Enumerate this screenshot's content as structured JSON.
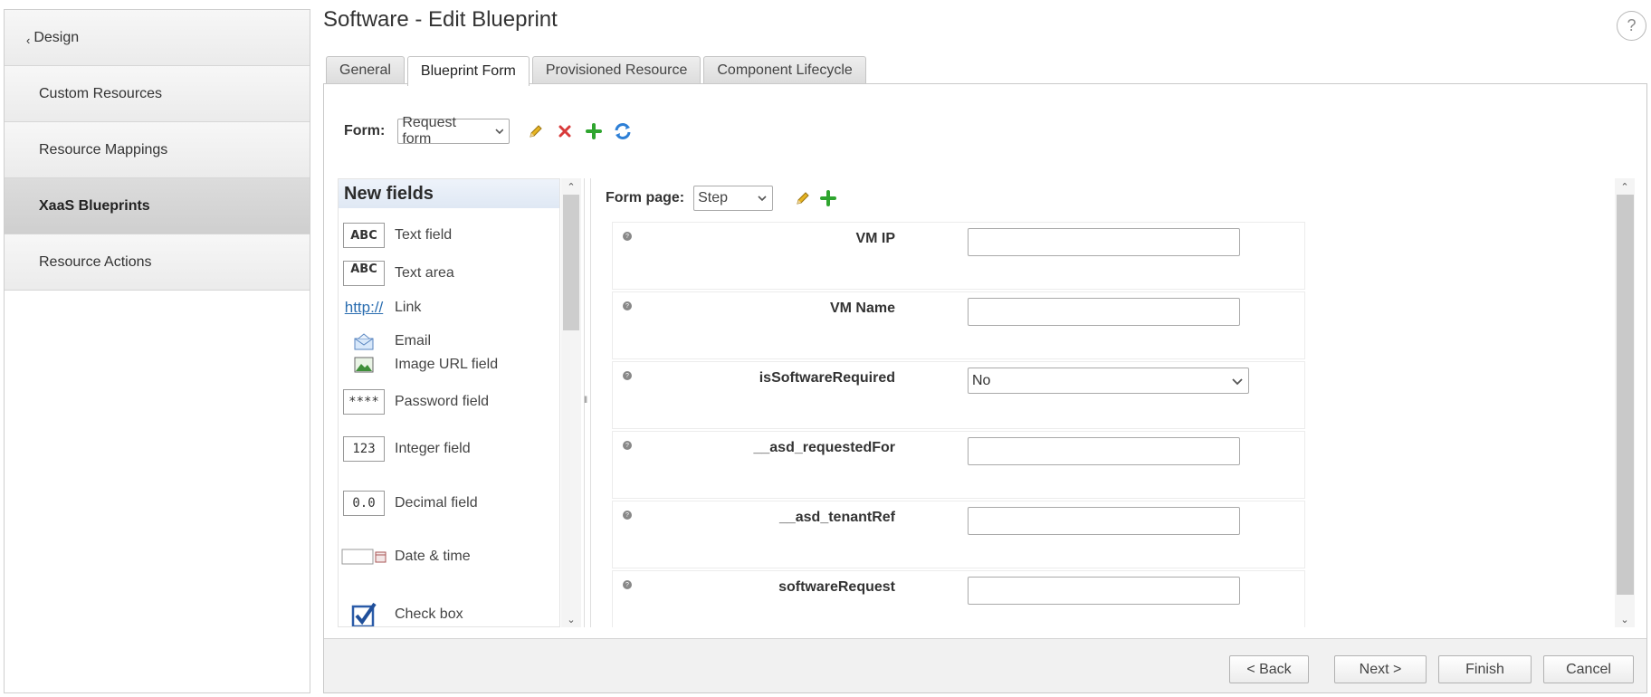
{
  "sidebar": {
    "back_label": "Design",
    "items": [
      {
        "label": "Custom Resources"
      },
      {
        "label": "Resource Mappings"
      },
      {
        "label": "XaaS Blueprints"
      },
      {
        "label": "Resource Actions"
      }
    ],
    "active": "XaaS Blueprints"
  },
  "header": {
    "title": "Software - Edit Blueprint",
    "help": "?"
  },
  "tabs": [
    {
      "label": "General"
    },
    {
      "label": "Blueprint Form"
    },
    {
      "label": "Provisioned Resource"
    },
    {
      "label": "Component Lifecycle"
    }
  ],
  "active_tab": "Blueprint Form",
  "form": {
    "label": "Form:",
    "selected": "Request form"
  },
  "new_fields": {
    "title": "New fields",
    "items": [
      {
        "label": "Text field",
        "icon": "ABC"
      },
      {
        "label": "Text area",
        "icon": "ABC"
      },
      {
        "label": "Link",
        "icon": "http://"
      },
      {
        "label": "Email",
        "icon": "email-icon"
      },
      {
        "label": "Image URL field",
        "icon": "image-icon"
      },
      {
        "label": "Password field",
        "icon": "****"
      },
      {
        "label": "Integer field",
        "icon": "123"
      },
      {
        "label": "Decimal field",
        "icon": "0.0"
      },
      {
        "label": "Date & time",
        "icon": "calendar-icon"
      },
      {
        "label": "Check box",
        "icon": "checkbox-icon"
      }
    ]
  },
  "form_page": {
    "label": "Form page:",
    "selected": "Step"
  },
  "fields": [
    {
      "label": "VM IP",
      "type": "text",
      "value": ""
    },
    {
      "label": "VM Name",
      "type": "text",
      "value": ""
    },
    {
      "label": "isSoftwareRequired",
      "type": "select",
      "value": "No"
    },
    {
      "label": "__asd_requestedFor",
      "type": "text",
      "value": ""
    },
    {
      "label": "__asd_tenantRef",
      "type": "text",
      "value": ""
    },
    {
      "label": "softwareRequest",
      "type": "text",
      "value": ""
    }
  ],
  "footer": {
    "back": "< Back",
    "next": "Next >",
    "finish": "Finish",
    "cancel": "Cancel"
  },
  "colors": {
    "edit": "#d9a520",
    "delete": "#d83a3a",
    "add": "#2fa52f",
    "refresh": "#2d7fd6"
  }
}
